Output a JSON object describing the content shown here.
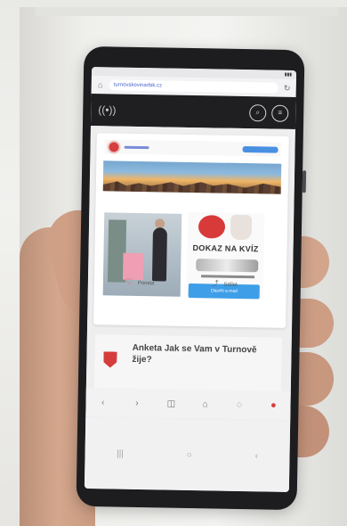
{
  "address": {
    "url": "turnovskovinarbik.cz"
  },
  "promo": {
    "title": "DOKAZ NA KVÍZ",
    "button_label": "Otevřít e-mail"
  },
  "actions": {
    "like_label": "Ponsta",
    "share_label": "Sdílet"
  },
  "article": {
    "title": "Anketa Jak se Vam v Turnově žije?"
  },
  "icons": {
    "home": "home-icon",
    "reload": "reload-icon",
    "search": "search-icon",
    "menu": "menu-icon",
    "heart": "heart-icon",
    "share": "share-icon"
  },
  "colors": {
    "header": "#1f1f22",
    "accent_red": "#d43e3e",
    "accent_blue": "#3e9ee8"
  }
}
